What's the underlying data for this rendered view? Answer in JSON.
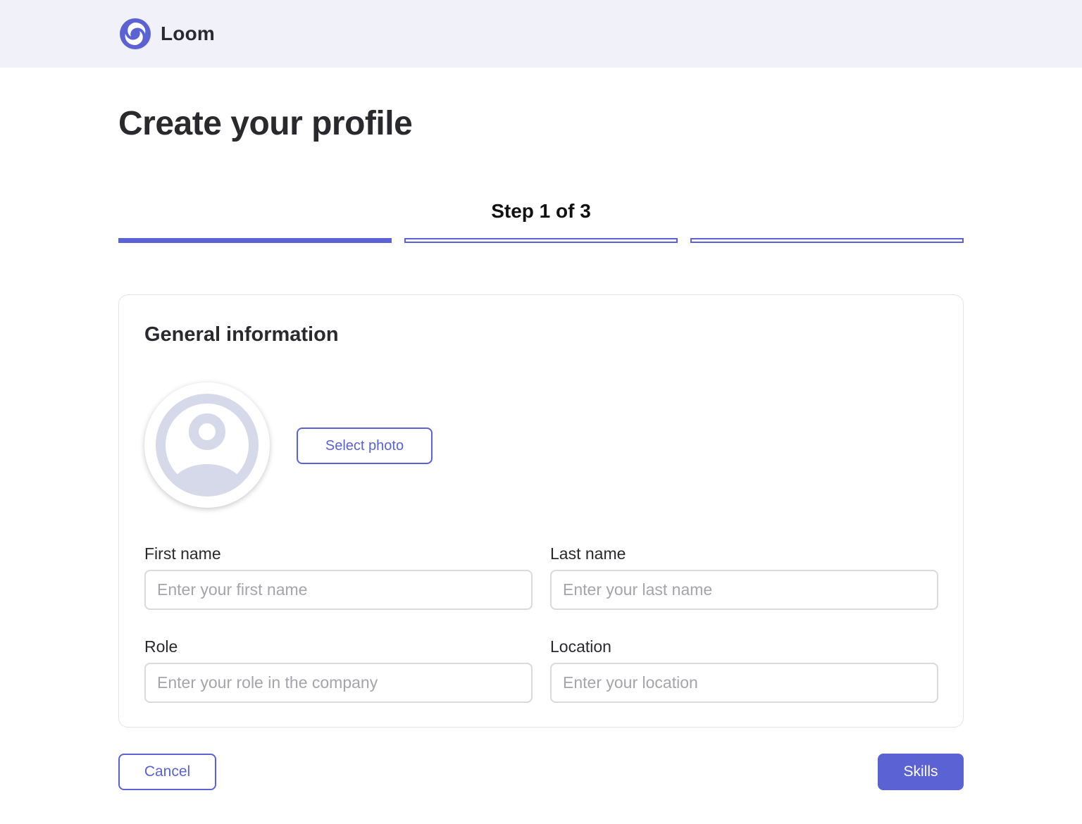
{
  "header": {
    "brand_name": "Loom",
    "logo_icon": "loom-swirl-icon"
  },
  "page": {
    "title": "Create your profile"
  },
  "progress": {
    "label": "Step 1 of 3",
    "current_step": 1,
    "total_steps": 3,
    "accent_color": "#5a62d4"
  },
  "card": {
    "title": "General information",
    "avatar_icon": "user-avatar-placeholder-icon",
    "select_photo_label": "Select photo",
    "fields": {
      "first_name": {
        "label": "First name",
        "value": "",
        "placeholder": "Enter your first name"
      },
      "last_name": {
        "label": "Last name",
        "value": "",
        "placeholder": "Enter your last name"
      },
      "role": {
        "label": "Role",
        "value": "",
        "placeholder": "Enter your role in the company"
      },
      "location": {
        "label": "Location",
        "value": "",
        "placeholder": "Enter your location"
      }
    }
  },
  "footer": {
    "cancel_label": "Cancel",
    "next_label": "Skills"
  }
}
